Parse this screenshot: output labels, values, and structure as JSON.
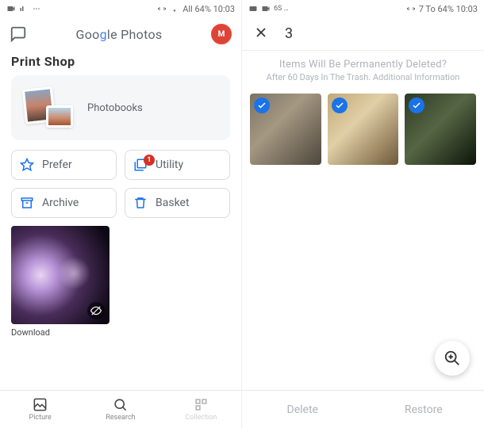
{
  "left": {
    "status": {
      "leftIcons": "■ 4G …",
      "rightText": "All 64% 10:03"
    },
    "appTitlePlain": "Goo",
    "appTitleAccent": "g",
    "appTitleRest": "le Photos",
    "avatarInitials": "M",
    "sectionTitle": "Print Shop",
    "card": {
      "label": "Photobooks"
    },
    "buttons": {
      "prefer": "Prefer",
      "utility": "Utility",
      "utilityBadge": "1",
      "archive": "Archive",
      "basket": "Basket"
    },
    "download": "Download",
    "tabs": {
      "picture": "Picture",
      "research": "Research",
      "collection": "Collection"
    }
  },
  "right": {
    "status": {
      "leftIcons": "■ ■ 6S …",
      "rightText": "7 To 64% 10:03"
    },
    "count": "3",
    "warning": "Items Will Be Permanently Deleted?",
    "subtext": "After 60 Days In The Trash. Additional Information",
    "actions": {
      "delete": "Delete",
      "restore": "Restore"
    }
  }
}
